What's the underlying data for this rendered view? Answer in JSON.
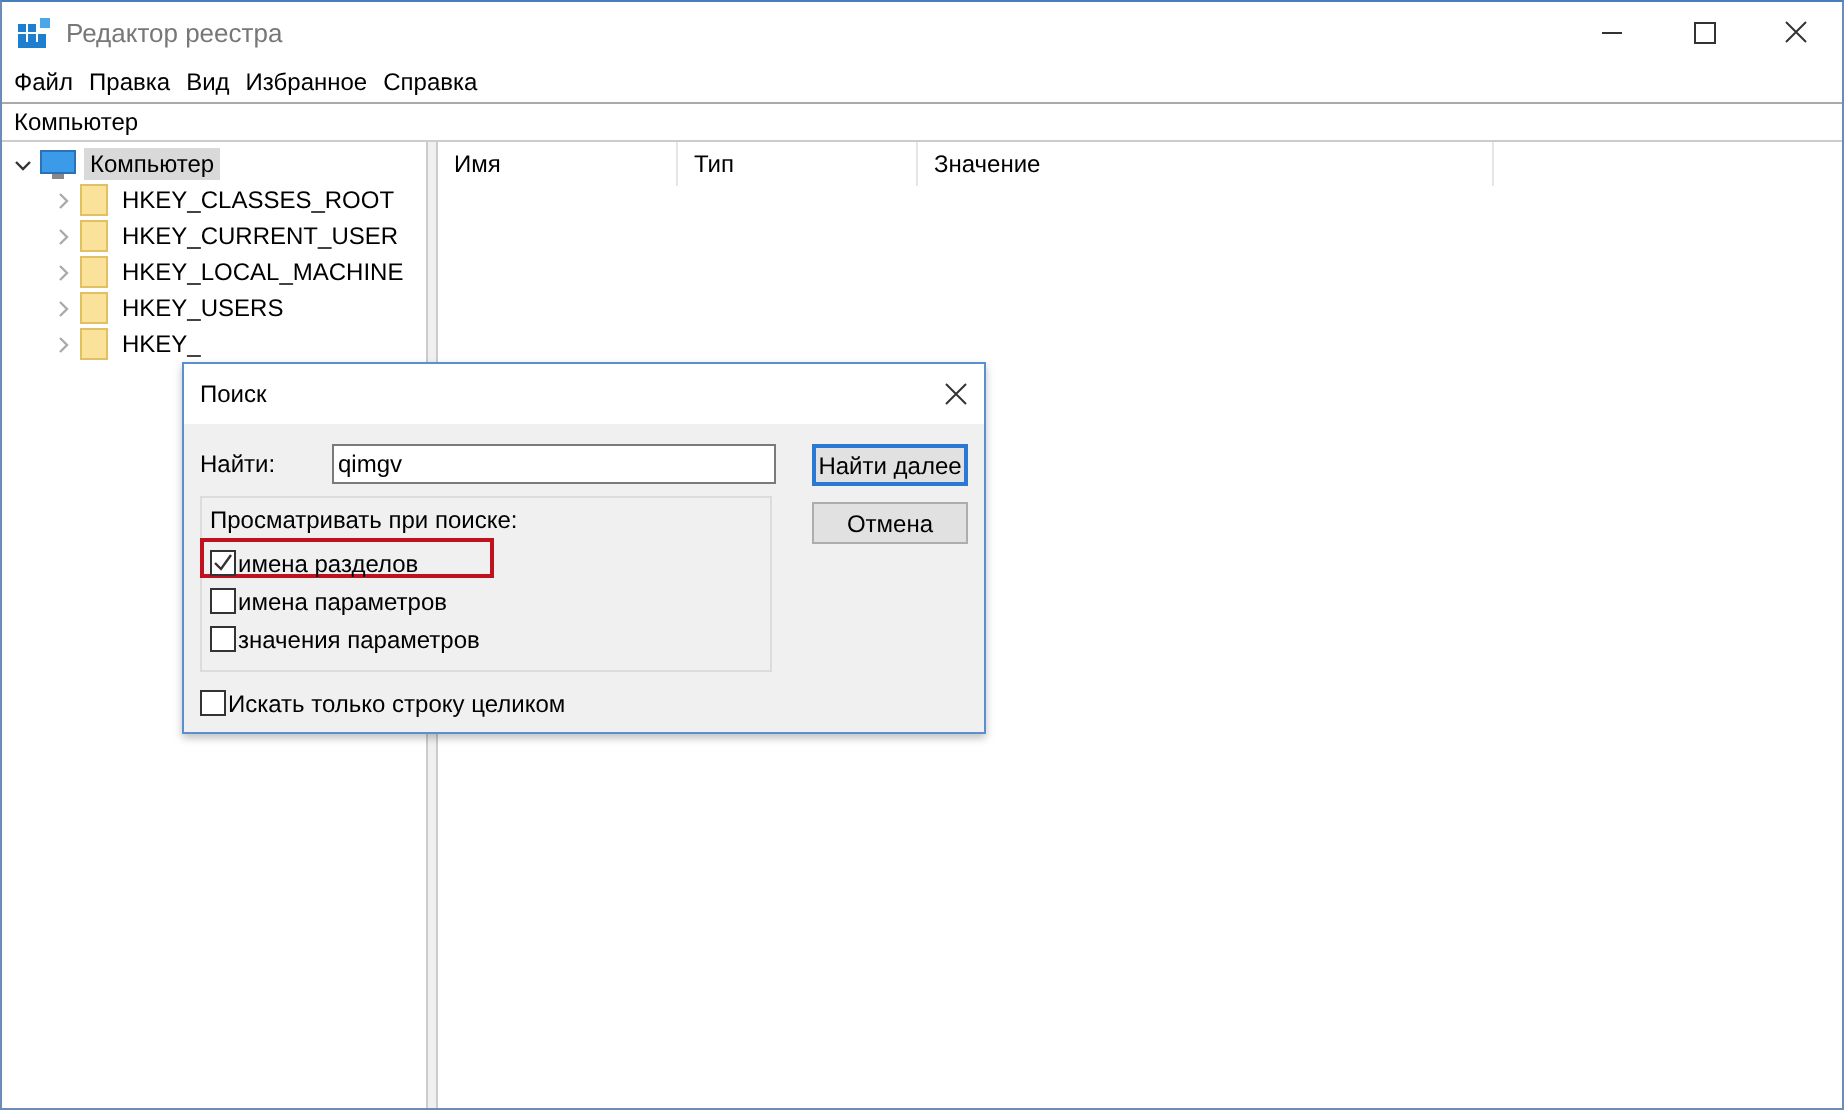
{
  "window": {
    "title": "Редактор реестра"
  },
  "menu": [
    "Файл",
    "Правка",
    "Вид",
    "Избранное",
    "Справка"
  ],
  "address": "Компьютер",
  "tree": {
    "label": "Компьютер",
    "expanded": true,
    "selected": true,
    "children": [
      {
        "label": "HKEY_CLASSES_ROOT",
        "expanded": false,
        "selected": false
      },
      {
        "label": "HKEY_CURRENT_USER",
        "expanded": false,
        "selected": false
      },
      {
        "label": "HKEY_LOCAL_MACHINE",
        "expanded": false,
        "selected": false
      },
      {
        "label": "HKEY_USERS",
        "expanded": false,
        "selected": false
      },
      {
        "label": "HKEY_",
        "expanded": false,
        "selected": false
      }
    ]
  },
  "columns": [
    "Имя",
    "Тип",
    "Значение"
  ],
  "dialog": {
    "title": "Поиск",
    "find_label": "Найти:",
    "find_value": "qimgv",
    "group_label": "Просматривать при поиске:",
    "options": [
      {
        "label": "имена разделов",
        "checked": true,
        "highlighted": true
      },
      {
        "label": "имена параметров",
        "checked": false,
        "highlighted": false
      },
      {
        "label": "значения параметров",
        "checked": false,
        "highlighted": false
      }
    ],
    "whole_string": {
      "label": "Искать только строку целиком",
      "checked": false
    },
    "buttons": [
      {
        "label": "Найти далее",
        "default": true
      },
      {
        "label": "Отмена",
        "default": false
      }
    ]
  }
}
